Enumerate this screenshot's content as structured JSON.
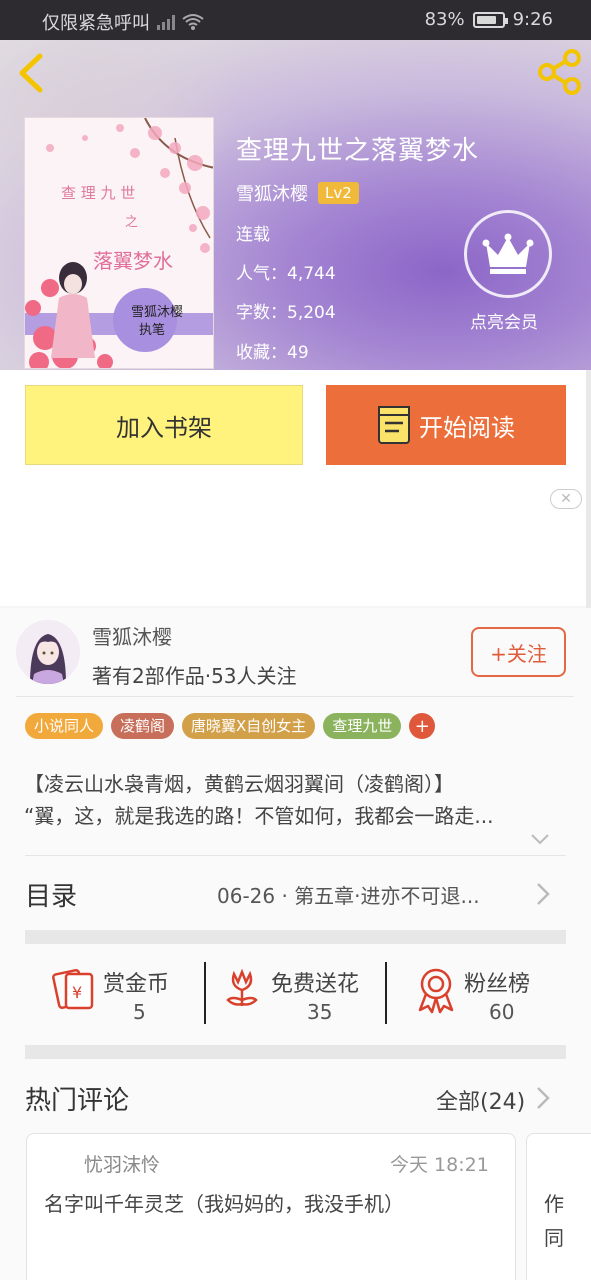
{
  "status_bar": {
    "carrier": "仅限紧急呼叫",
    "battery": "83%",
    "battery_level": 0.83,
    "time": "9:26"
  },
  "book": {
    "title": "查理九世之落翼梦水",
    "author": "雪狐沐樱",
    "level": "Lv2",
    "status": "连载",
    "popularity_label": "人气：",
    "popularity": "4,744",
    "words_label": "字数：",
    "words": "5,204",
    "favorites_label": "收藏：",
    "favorites": "49"
  },
  "vip": {
    "label": "点亮会员"
  },
  "actions": {
    "add_shelf": "加入书架",
    "start_reading": "开始阅读"
  },
  "ad": {
    "close": "✕"
  },
  "author_card": {
    "name": "雪狐沐樱",
    "stats": "著有2部作品·53人关注",
    "follow": "+关注"
  },
  "tags": [
    {
      "label": "小说同人",
      "color": "#f2a93b"
    },
    {
      "label": "凌鹤阁",
      "color": "#c76f5a"
    },
    {
      "label": "唐晓翼X自创女主",
      "color": "#d3a04a"
    },
    {
      "label": "查理九世",
      "color": "#8bb35e"
    }
  ],
  "tag_more": "+",
  "description": {
    "line1": "【凌云山水袅青烟，黄鹤云烟羽翼间（凌鹤阁）】",
    "line2": "“翼，这，就是我选的路！不管如何，我都会一路走..."
  },
  "toc": {
    "label": "目录",
    "latest": "06-26 · 第五章·进亦不可退..."
  },
  "rewards": [
    {
      "label": "赏金币",
      "value": "5"
    },
    {
      "label": "免费送花",
      "value": "35"
    },
    {
      "label": "粉丝榜",
      "value": "60"
    }
  ],
  "hot_comments": {
    "title": "热门评论",
    "all": "全部(24)",
    "items": [
      {
        "user": "忧羽沫怜",
        "time": "今天 18:21",
        "text": "名字叫千年灵芝（我妈妈的，我没手机）"
      }
    ],
    "next_peek": [
      "作",
      "同"
    ]
  },
  "colors": {
    "accent": "#ec6e3a",
    "shelf": "#fff37e",
    "follow": "#e36844",
    "icon_red": "#d9412d"
  }
}
